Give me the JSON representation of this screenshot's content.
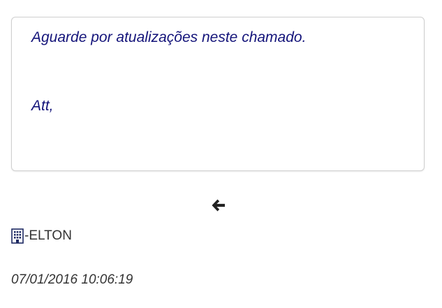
{
  "message": {
    "lines": [
      "Aguarde por atualizações neste chamado.",
      "Att,"
    ]
  },
  "nav": {
    "back_icon": "arrow-left-icon"
  },
  "author": {
    "icon": "building-icon",
    "name": "-ELTON"
  },
  "timestamp": "07/01/2016 10:06:19",
  "colors": {
    "message_text": "#14147a",
    "body_text": "#333333",
    "card_border": "#cfcfcf",
    "icon": "#1e2a63"
  }
}
